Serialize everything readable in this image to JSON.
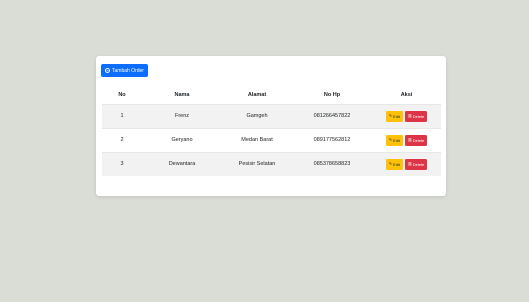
{
  "add_button": {
    "icon": "plus-circle-icon",
    "label": "Tambah Order"
  },
  "table": {
    "headers": {
      "no": "No",
      "nama": "Nama",
      "alamat": "Alamat",
      "hp": "No Hp",
      "aksi": "Aksi"
    },
    "rows": [
      {
        "no": "1",
        "nama": "Frenz",
        "alamat": "Gamgeh",
        "hp": "081266457822"
      },
      {
        "no": "2",
        "nama": "Geryano",
        "alamat": "Medan Barat",
        "hp": "089177562812"
      },
      {
        "no": "3",
        "nama": "Dewantara",
        "alamat": "Pesisir Selatan",
        "hp": "085378658823"
      }
    ],
    "actions": {
      "edit_label": "Edit",
      "delete_label": "Delete"
    }
  },
  "colors": {
    "primary": "#0d6efd",
    "warning": "#ffc107",
    "danger": "#dc3545",
    "background": "#dadcd6"
  }
}
